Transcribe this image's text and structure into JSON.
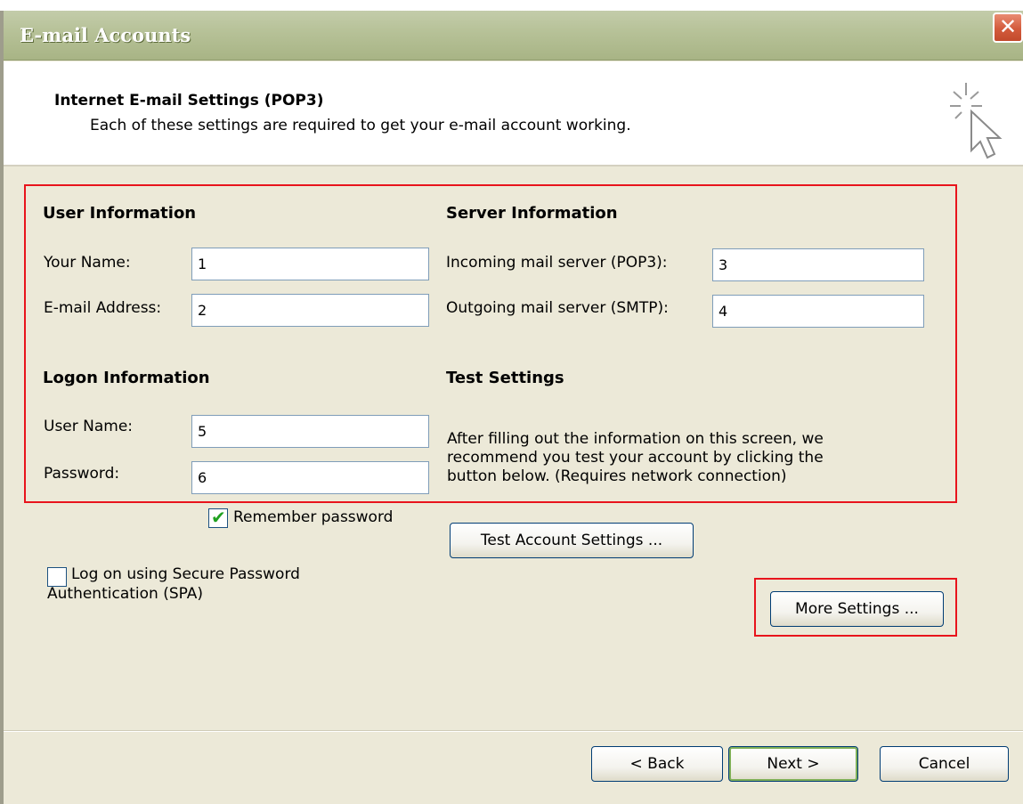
{
  "window": {
    "title": "E-mail Accounts",
    "close_glyph": "✕"
  },
  "header": {
    "title": "Internet E-mail Settings (POP3)",
    "subtitle": "Each of these settings are required to get your e-mail account working.",
    "icon": "cursor-sparkle-icon"
  },
  "user_info": {
    "heading": "User Information",
    "name_label": "Your Name:",
    "name_value": "1",
    "email_label": "E-mail Address:",
    "email_value": "2"
  },
  "server_info": {
    "heading": "Server Information",
    "incoming_label": "Incoming mail server (POP3):",
    "incoming_value": "3",
    "outgoing_label": "Outgoing mail server (SMTP):",
    "outgoing_value": "4"
  },
  "logon_info": {
    "heading": "Logon Information",
    "username_label": "User Name:",
    "username_value": "5",
    "password_label": "Password:",
    "password_value": "6",
    "remember_label": "Remember password",
    "remember_checked": true,
    "spa_label_line1": "Log on using Secure Password",
    "spa_label_line2": "Authentication (SPA)",
    "spa_checked": false
  },
  "test_settings": {
    "heading": "Test Settings",
    "desc_line1": "After filling out the information on this screen, we",
    "desc_line2": "recommend you test your account by clicking the",
    "desc_line3": "button below. (Requires network connection)",
    "test_button": "Test Account Settings ..."
  },
  "more_settings_button": "More Settings ...",
  "footer": {
    "back_button": "< Back",
    "next_button": "Next >",
    "cancel_button": "Cancel"
  },
  "colors": {
    "highlight": "#e8141c",
    "dialog_bg": "#ece9d8",
    "titlebar": "#b6c197"
  }
}
